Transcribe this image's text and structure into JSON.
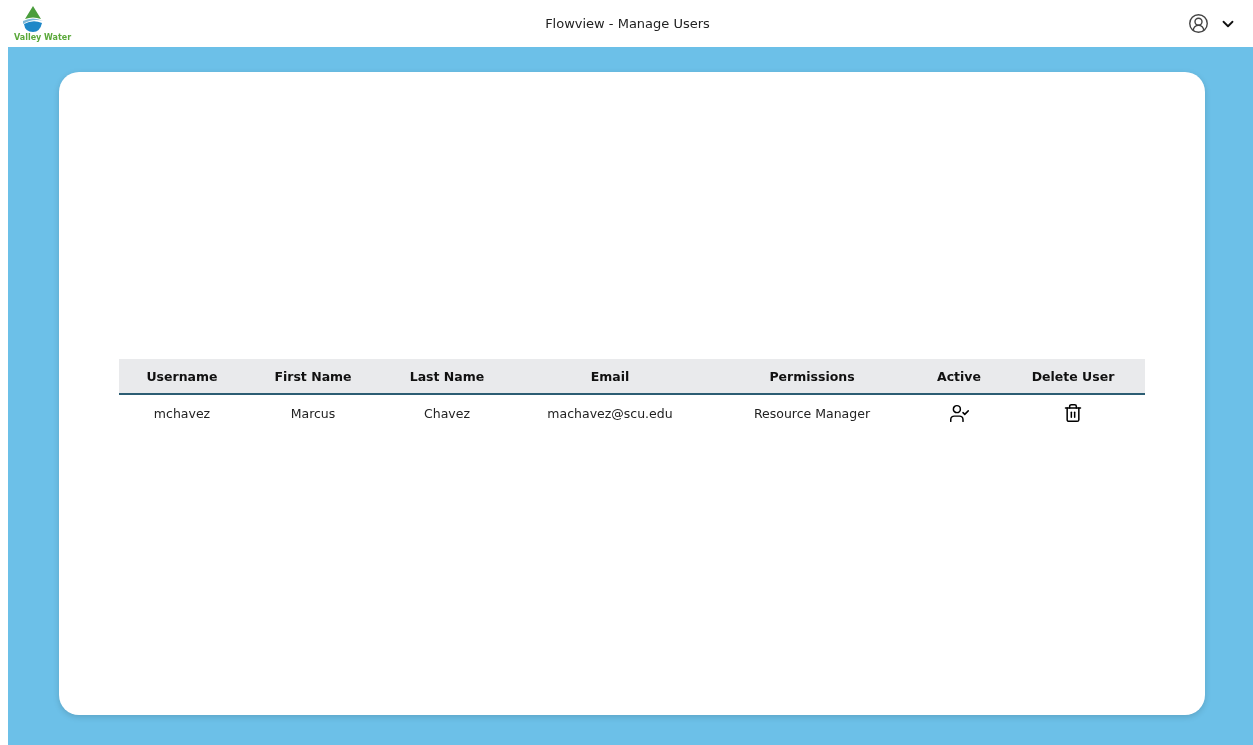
{
  "header": {
    "logo_text": "Valley Water",
    "title": "Flowview - Manage Users"
  },
  "table": {
    "columns": [
      "Username",
      "First Name",
      "Last Name",
      "Email",
      "Permissions",
      "Active",
      "Delete User"
    ],
    "rows": [
      {
        "username": "mchavez",
        "first_name": "Marcus",
        "last_name": "Chavez",
        "email": "machavez@scu.edu",
        "permissions": "Resource Manager",
        "active": true
      }
    ]
  }
}
